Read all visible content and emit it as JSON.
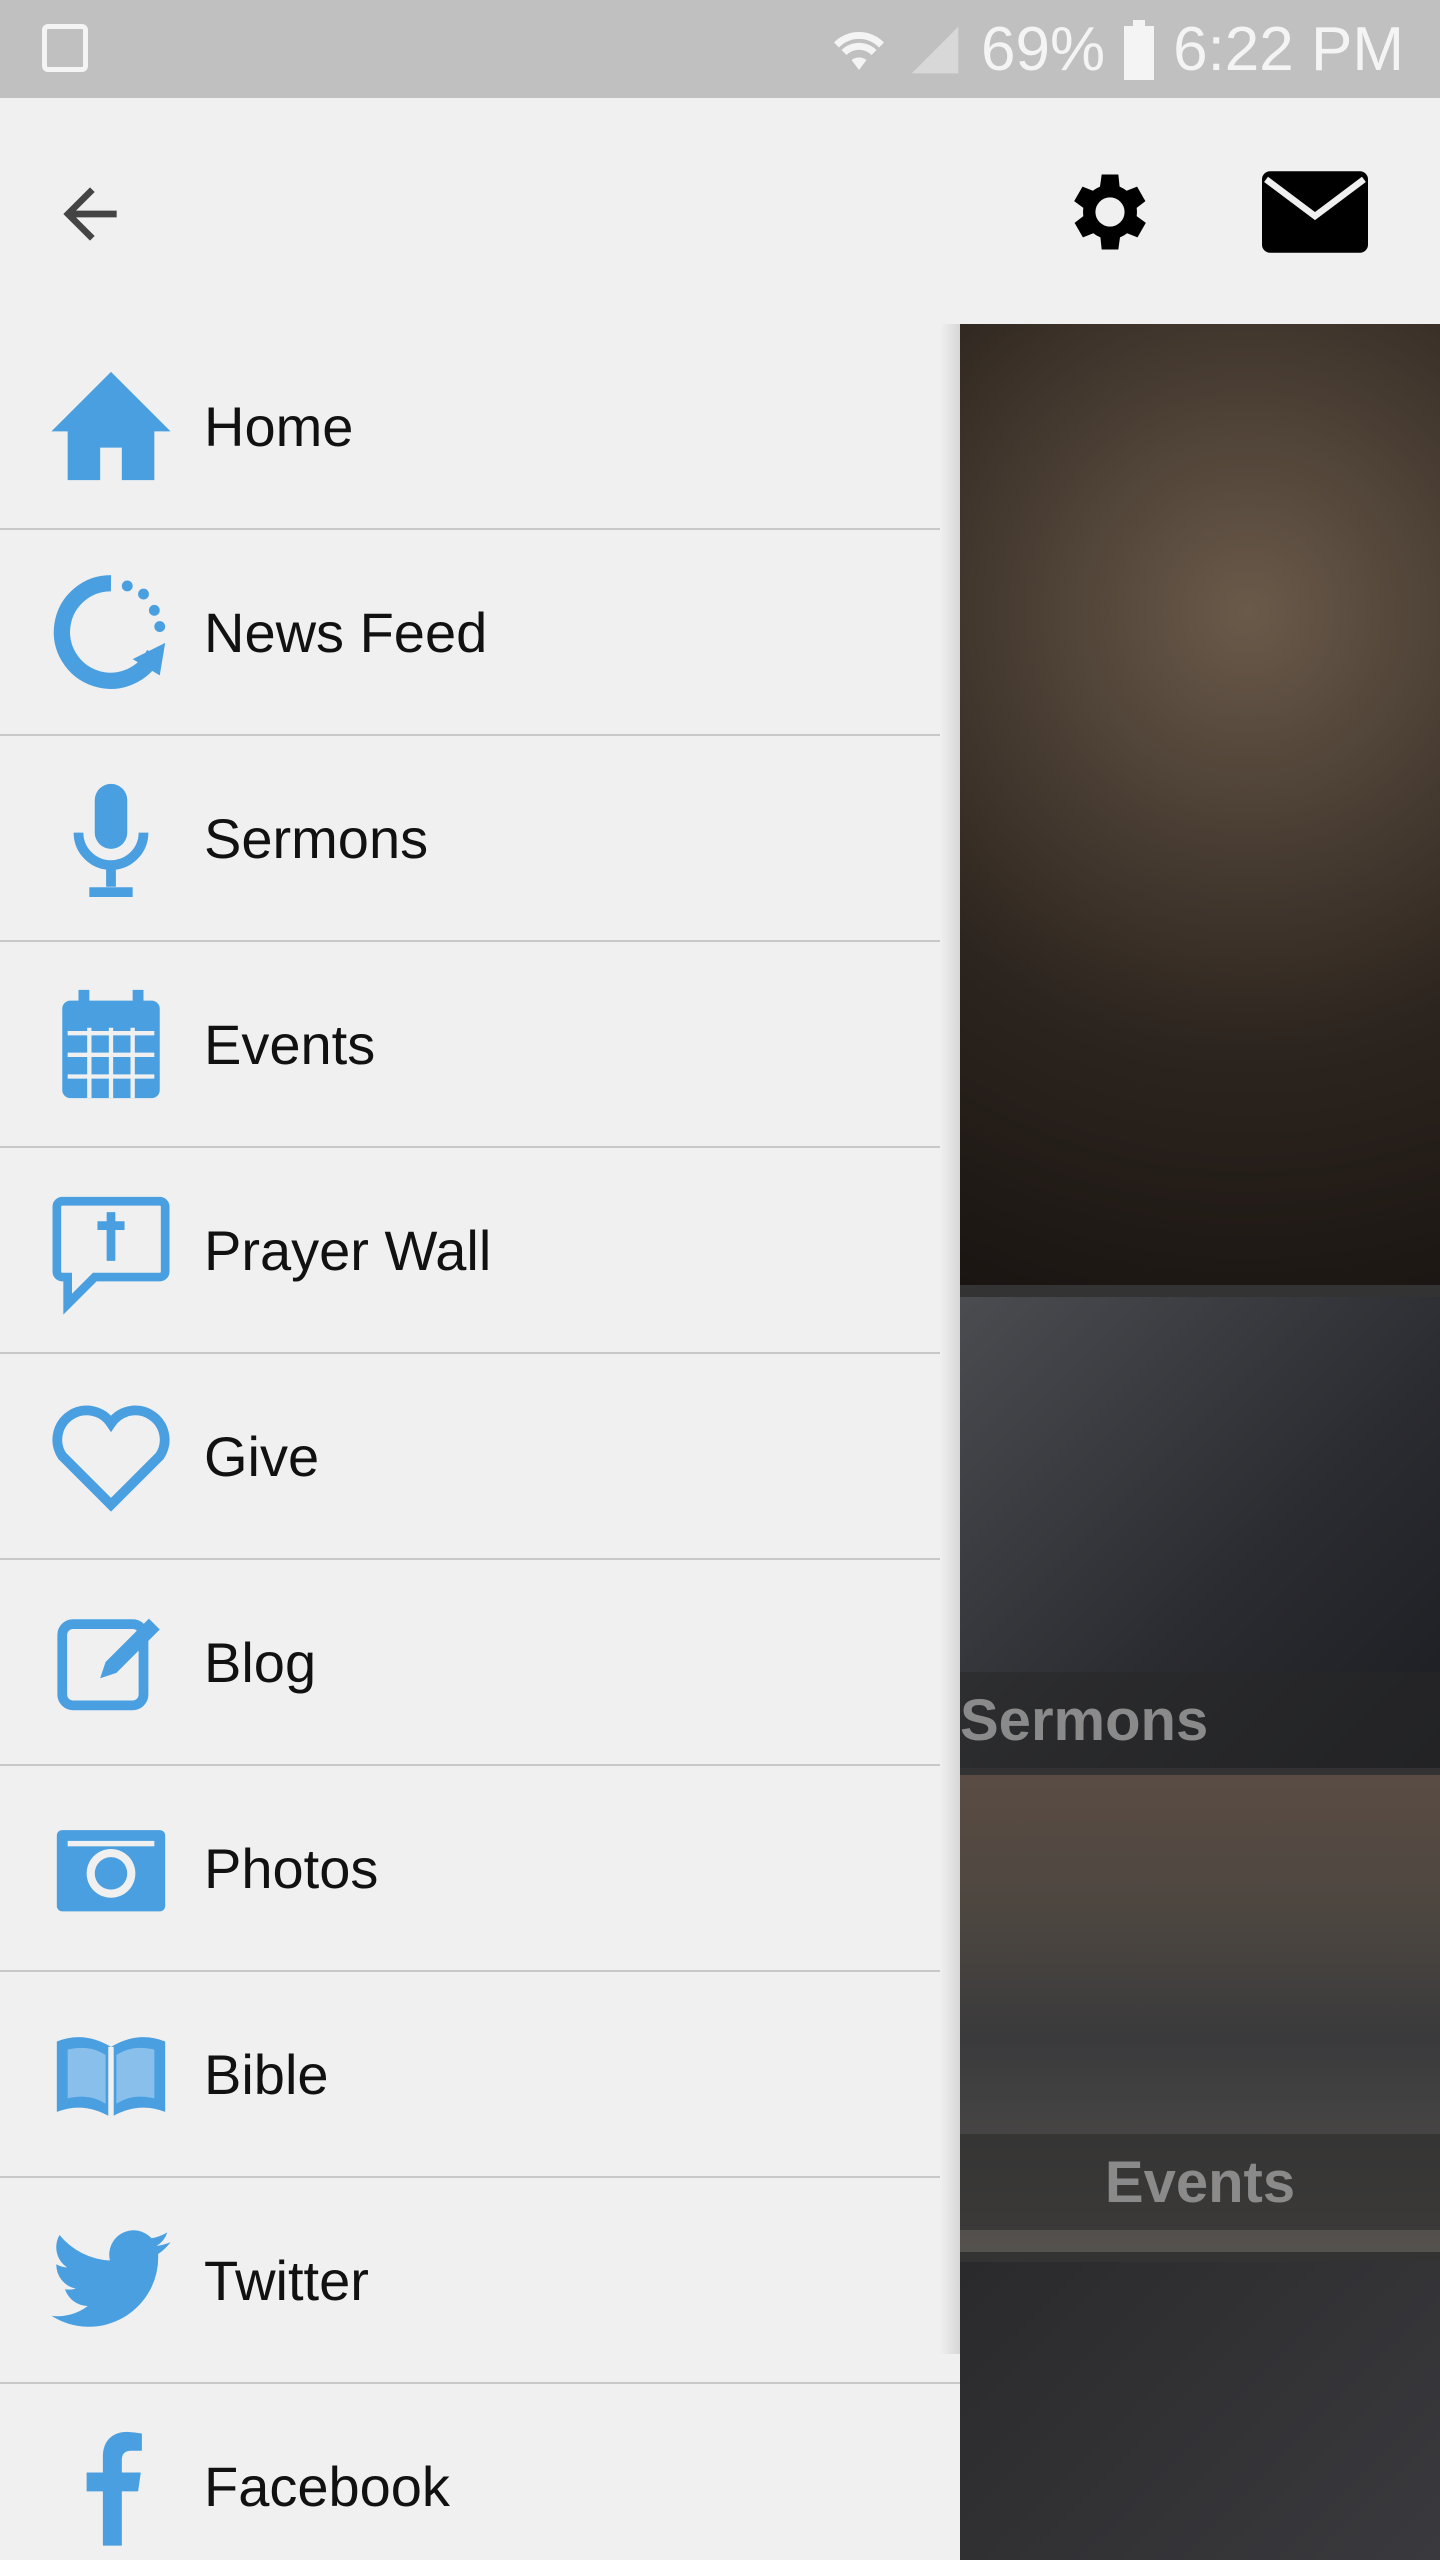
{
  "status_bar": {
    "battery": "69%",
    "time": "6:22 PM",
    "icons": [
      "gallery-icon",
      "wifi-icon",
      "signal-icon",
      "battery-icon"
    ]
  },
  "toolbar": {
    "icons": [
      "back-arrow-icon",
      "gear-icon",
      "mail-icon"
    ]
  },
  "accent_color": "#4a9fe0",
  "drawer": {
    "items": [
      {
        "label": "Home",
        "icon": "home-icon"
      },
      {
        "label": "News Feed",
        "icon": "refresh-icon"
      },
      {
        "label": "Sermons",
        "icon": "microphone-icon"
      },
      {
        "label": "Events",
        "icon": "calendar-icon"
      },
      {
        "label": "Prayer Wall",
        "icon": "prayer-bubble-icon"
      },
      {
        "label": "Give",
        "icon": "heart-icon"
      },
      {
        "label": "Blog",
        "icon": "edit-icon"
      },
      {
        "label": "Photos",
        "icon": "camera-icon"
      },
      {
        "label": "Bible",
        "icon": "book-icon"
      },
      {
        "label": "Twitter",
        "icon": "twitter-icon"
      },
      {
        "label": "Facebook",
        "icon": "facebook-icon"
      }
    ]
  },
  "content": {
    "tiles": [
      {
        "caption": ""
      },
      {
        "caption": "Sermons"
      },
      {
        "caption": "Events"
      },
      {
        "caption": ""
      }
    ]
  }
}
